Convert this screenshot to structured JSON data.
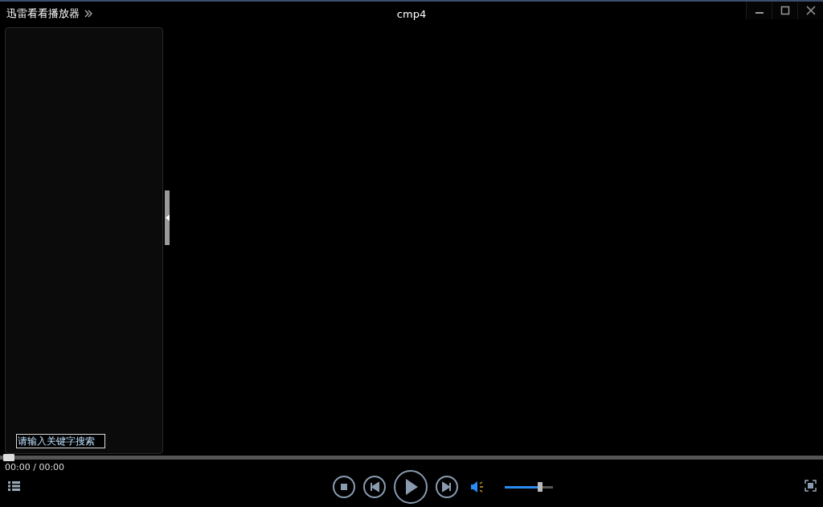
{
  "app_name": "迅雷看看播放器",
  "title": "cmp4",
  "sidebar": {
    "search": {
      "placeholder": "请输入关键字搜索"
    }
  },
  "seek": {
    "level": 0
  },
  "time": "00:00 / 00:00",
  "volume": {
    "level": 0.73
  }
}
